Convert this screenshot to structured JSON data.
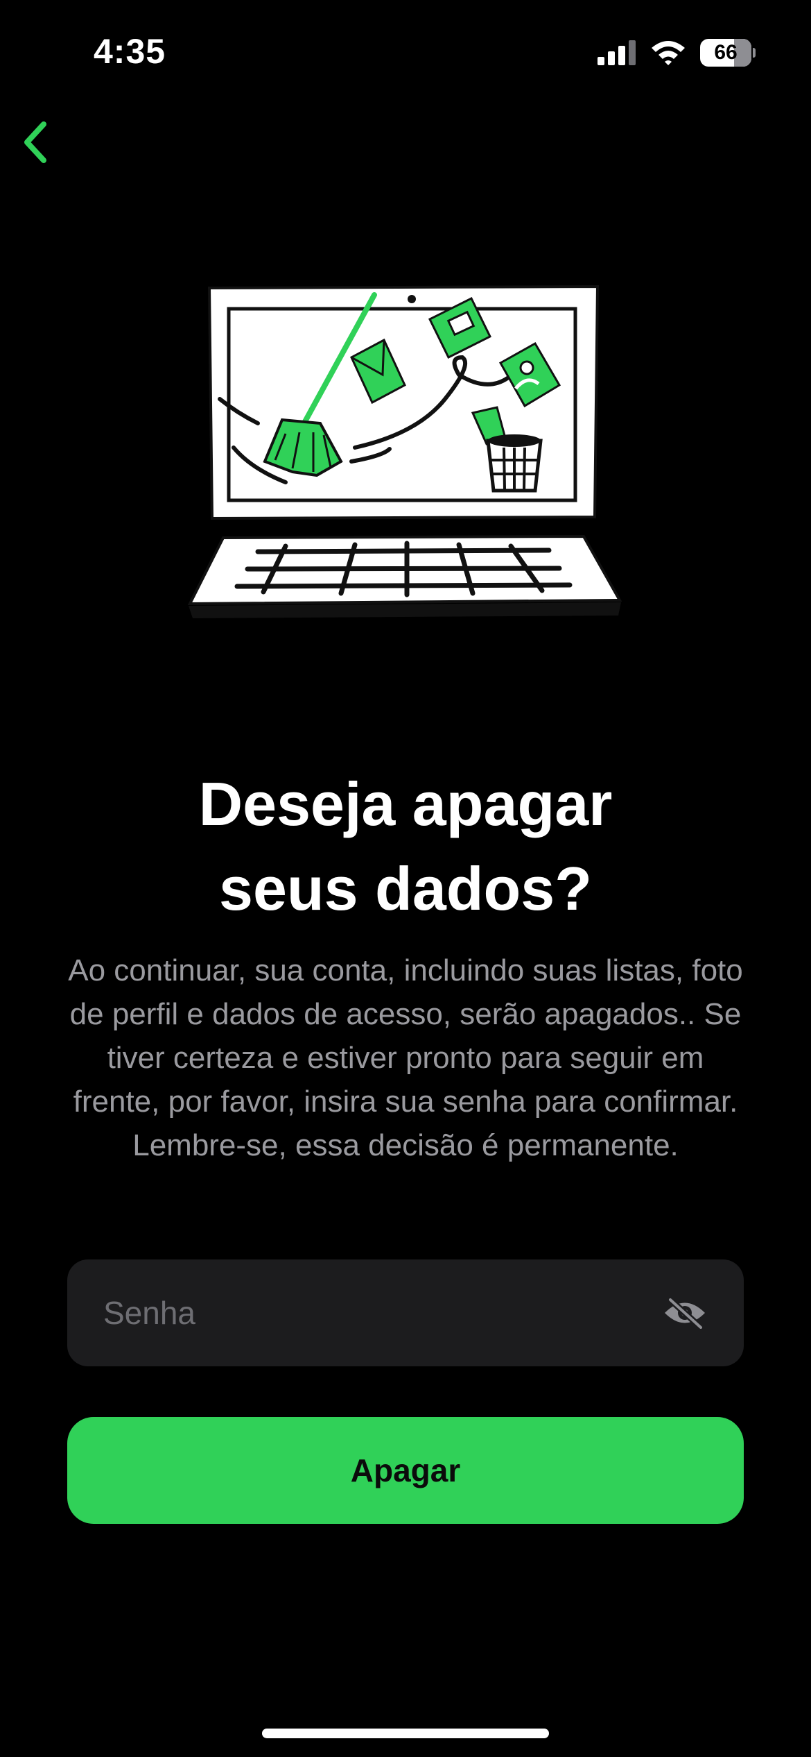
{
  "status_bar": {
    "time": "4:35",
    "battery_level": "66",
    "battery_fraction": 0.66,
    "icons": [
      "cellular-signal-icon",
      "wifi-icon",
      "battery-icon"
    ]
  },
  "navigation": {
    "back_icon": "chevron-left-icon"
  },
  "illustration": {
    "icon": "laptop-cleanup-illustration"
  },
  "content": {
    "title_line1": "Deseja apagar",
    "title_line2": "seus dados?",
    "description": "Ao continuar, sua conta, incluindo suas listas, foto de perfil e dados de acesso, serão apagados.. Se tiver certeza e estiver pronto para seguir em frente, por favor, insira sua senha para confirmar. Lembre-se, essa decisão é permanente."
  },
  "password": {
    "placeholder": "Senha",
    "value": "",
    "toggle_icon": "eye-slash-icon"
  },
  "actions": {
    "delete_label": "Apagar"
  },
  "colors": {
    "accent": "#30d158",
    "background": "#000000",
    "field": "#1c1c1e",
    "secondary_text": "#9a9a9f"
  }
}
